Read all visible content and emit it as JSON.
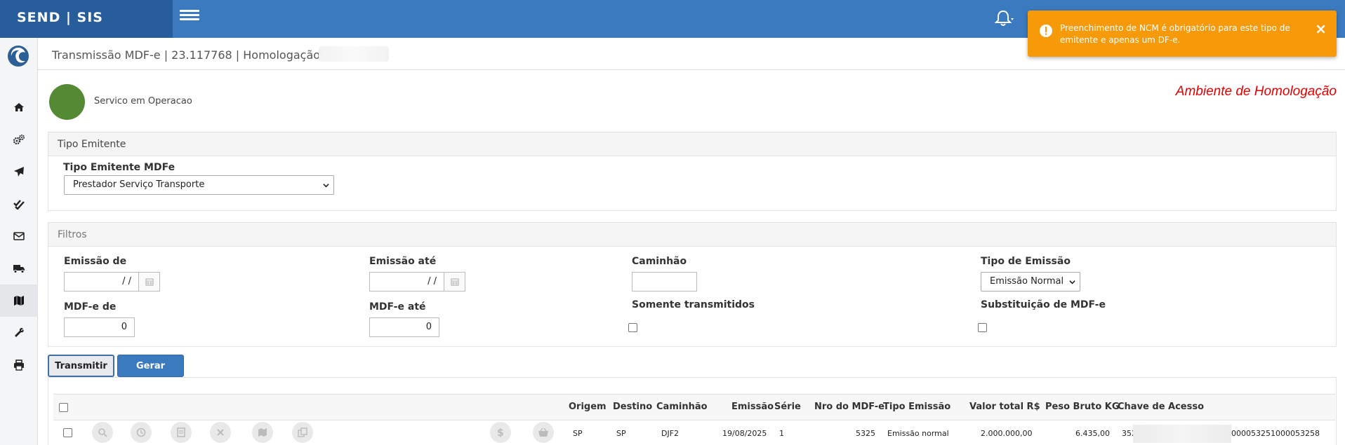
{
  "app": {
    "brand": "SEND | SIS"
  },
  "toast": {
    "message": "Preenchimento de NCM é obrigatório para este tipo de emitente e apenas um DF-e.",
    "close": "×"
  },
  "header": {
    "title": "Transmissão MDF-e | 23.117768 | Homologação |"
  },
  "status": {
    "text": "Servico em Operacao",
    "color": "#548a34"
  },
  "environment": {
    "text": "Ambiente de Homologação",
    "color": "#e40000"
  },
  "sidebar": {
    "items": [
      "home-icon",
      "cogs-icon",
      "paper-plane-icon",
      "double-check-icon",
      "envelope-icon",
      "truck-icon",
      "map-icon",
      "wrench-icon",
      "print-icon"
    ],
    "active": "map-icon"
  },
  "tipo_emitente": {
    "panel_title": "Tipo Emitente",
    "label": "Tipo Emitente MDFe",
    "value": "Prestador Serviço Transporte"
  },
  "filtros": {
    "panel_title": "Filtros",
    "emissao_de": {
      "label": "Emissão de",
      "value": "/ /"
    },
    "emissao_ate": {
      "label": "Emissão até",
      "value": "/ /"
    },
    "caminhao": {
      "label": "Caminhão",
      "value": ""
    },
    "tipo_emissao": {
      "label": "Tipo de Emissão",
      "value": "Emissão Normal"
    },
    "mdfe_de": {
      "label": "MDF-e de",
      "value": "0"
    },
    "mdfe_ate": {
      "label": "MDF-e até",
      "value": "0"
    },
    "somente_transmitidos": {
      "label": "Somente transmitidos",
      "checked": false
    },
    "substituicao": {
      "label": "Substituição de MDF-e",
      "checked": false
    }
  },
  "actions": {
    "transmitir": "Transmitir",
    "gerar": "Gerar"
  },
  "table": {
    "columns": [
      "Origem",
      "Destino",
      "Caminhão",
      "Emissão",
      "Série",
      "Nro do MDF-e",
      "Tipo Emissão",
      "Valor total R$",
      "Peso Bruto KG",
      "Chave de Acesso"
    ],
    "rows": [
      {
        "origem": "SP",
        "destino": "SP",
        "caminhao": "DJF2",
        "emissao": "19/08/2025",
        "serie": "1",
        "nro": "5325",
        "tipo": "Emissão normal",
        "valor": "2.000.000,00",
        "peso": "6.435,00",
        "chave_inicio": "352",
        "chave_fim": "000053251000053258"
      }
    ],
    "row_action_icons": [
      "search-icon",
      "clock-icon",
      "document-icon",
      "cancel-icon",
      "map-icon",
      "copy-icon",
      "dollar-icon",
      "basket-icon"
    ]
  }
}
